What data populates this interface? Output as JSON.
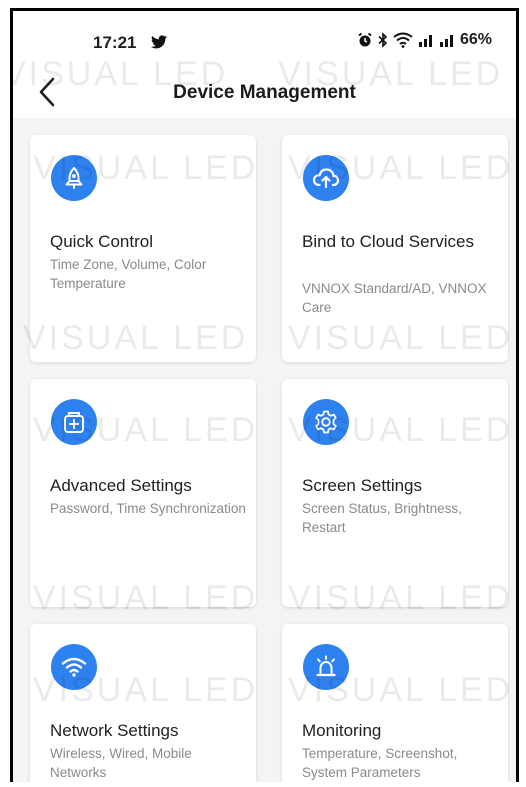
{
  "status_bar": {
    "time": "17:21",
    "battery": "66%",
    "icons": [
      "twitter-icon",
      "alarm-icon",
      "bluetooth-icon",
      "wifi-icon",
      "signal-icon",
      "signal-icon"
    ]
  },
  "header": {
    "title": "Device Management",
    "back_icon": "chevron-left-icon"
  },
  "watermark": "VISUAL LED",
  "cards": [
    {
      "title": "Quick Control",
      "description": "Time Zone, Volume, Color Temperature",
      "icon": "rocket-icon"
    },
    {
      "title": "Bind to Cloud Services",
      "description": "VNNOX Standard/AD, VNNOX Care",
      "icon": "cloud-upload-icon"
    },
    {
      "title": "Advanced Settings",
      "description": "Password, Time Synchronization",
      "icon": "box-plus-icon"
    },
    {
      "title": "Screen Settings",
      "description": "Screen Status, Brightness, Restart",
      "icon": "gear-icon"
    },
    {
      "title": "Network Settings",
      "description": "Wireless, Wired, Mobile Networks",
      "icon": "wifi-icon"
    },
    {
      "title": "Monitoring",
      "description": "Temperature, Screenshot, System Parameters",
      "icon": "alarm-light-icon"
    }
  ],
  "colors": {
    "accent": "#2e82f0",
    "background": "#f3f4f6",
    "card": "#ffffff",
    "description": "#8a8a8a"
  }
}
